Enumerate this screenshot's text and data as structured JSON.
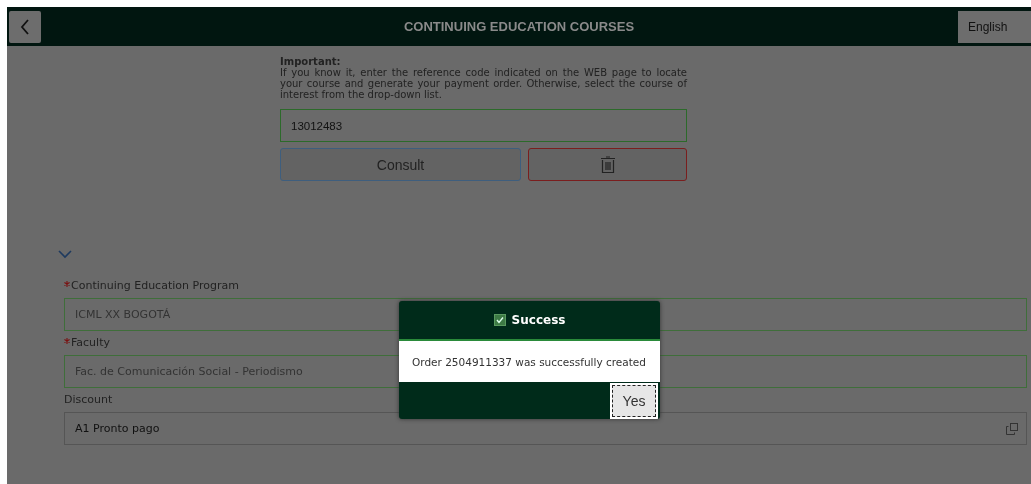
{
  "header": {
    "title": "CONTINUING EDUCATION COURSES",
    "language": "English"
  },
  "notice": {
    "title": "Important:",
    "text": "If you know it, enter the reference code indicated on the WEB page to locate your course and generate your payment order. Otherwise, select the course of interest from the drop-down list."
  },
  "reference_field": {
    "value": "13012483"
  },
  "buttons": {
    "consult": "Consult"
  },
  "section": {
    "expanded": true
  },
  "fields": [
    {
      "label": "Continuing Education Program",
      "required": true,
      "disabled": true,
      "value": "ICML XX BOGOTÁ"
    },
    {
      "label": "Faculty",
      "required": true,
      "disabled": true,
      "value": "Fac. de Comunicación Social - Periodismo"
    },
    {
      "label": "Discount",
      "required": false,
      "disabled": false,
      "value": "A1 Pronto pago"
    }
  ],
  "dialog": {
    "title": "Success",
    "message": "Order 2504911337 was successfully created",
    "button": "Yes"
  }
}
